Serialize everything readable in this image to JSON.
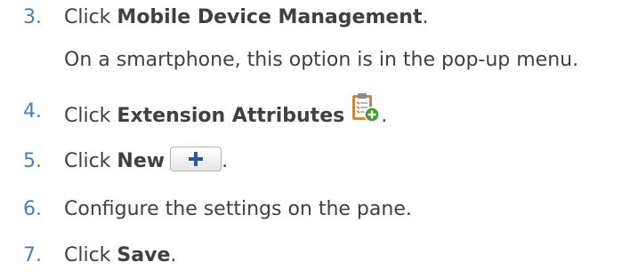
{
  "steps": [
    {
      "number": "3.",
      "prefix": "Click ",
      "bold": "Mobile Device Management",
      "suffix": ".",
      "note": "On a smartphone, this option is in the pop-up menu."
    },
    {
      "number": "4.",
      "prefix": "Click ",
      "bold": "Extension Attributes",
      "suffix": ".",
      "icon": "clipboard-add-icon"
    },
    {
      "number": "5.",
      "prefix": "Click ",
      "bold": "New",
      "suffix": ".",
      "icon": "plus-button-icon"
    },
    {
      "number": "6.",
      "text": "Configure the settings on the pane."
    },
    {
      "number": "7.",
      "prefix": "Click ",
      "bold": "Save",
      "suffix": "."
    }
  ],
  "colors": {
    "number": "#4a7fb5",
    "text": "#404040",
    "plus": "#2a5b9f"
  }
}
